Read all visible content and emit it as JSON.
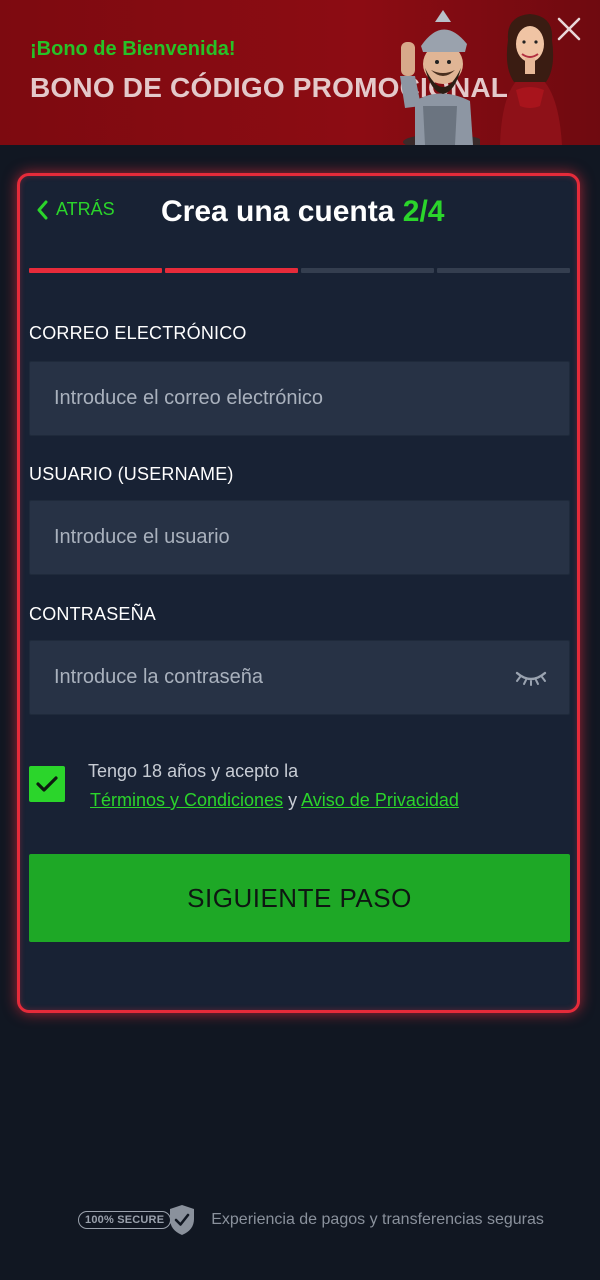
{
  "banner": {
    "kicker": "¡Bono de Bienvenida!",
    "headline": "BONO DE CÓDIGO PROMOCIONAL",
    "close_icon": "close-icon"
  },
  "form": {
    "back_label": "ATRÁS",
    "title": "Crea una cuenta",
    "step": "2/4",
    "progress": {
      "current_step": 2,
      "total_steps": 4
    },
    "email": {
      "label": "CORREO ELECTRÓNICO",
      "placeholder": "Introduce el correo electrónico",
      "value": ""
    },
    "username": {
      "label": "USUARIO (USERNAME)",
      "placeholder": "Introduce el usuario",
      "value": ""
    },
    "password": {
      "label": "CONTRASEÑA",
      "placeholder": "Introduce la contraseña",
      "value": "",
      "toggle_icon": "eye-closed-icon"
    },
    "terms": {
      "checked": true,
      "text": "Tengo 18 años y acepto la",
      "terms_link": "Términos y Condiciones",
      "conjunction": "y",
      "privacy_link": "Aviso de Privacidad"
    },
    "submit_label": "SIGUIENTE PASO"
  },
  "footer": {
    "badge": "100% SECURE",
    "text": "Experiencia de pagos y transferencias seguras"
  },
  "colors": {
    "accent_green": "#2bd52b",
    "accent_red": "#e52b3a",
    "button_green": "#1ea826",
    "banner_red": "#8c0c13",
    "background": "#111722",
    "card": "#182234"
  }
}
